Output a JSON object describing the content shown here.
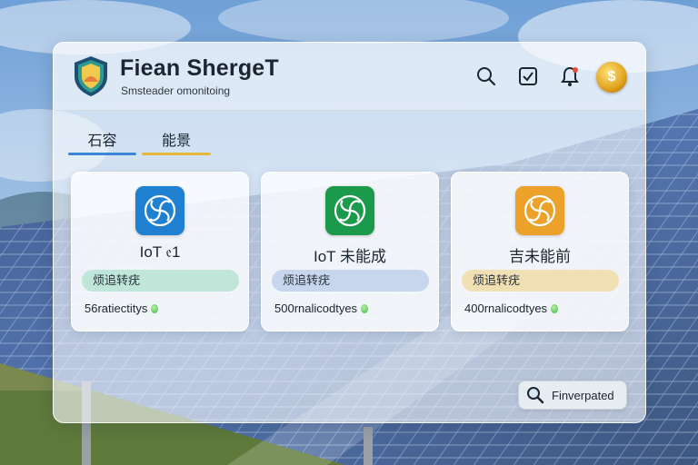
{
  "app": {
    "title": "Fiean ShergeT",
    "subtitle": "Smsteader omonitoing"
  },
  "header_icons": [
    "search-icon",
    "checkbox-icon",
    "bell-icon",
    "coin-avatar-icon"
  ],
  "avatar": {
    "symbol": "$"
  },
  "tabs": [
    {
      "label": "石容",
      "underline_color": "#3c86d6"
    },
    {
      "label": "能景",
      "underline_color": "#e6b83e"
    }
  ],
  "cards": [
    {
      "icon": "fan-swirl-icon",
      "icon_color": "#1f7fd0",
      "name": "IoT 𝔢1",
      "pill": "烦追转疣",
      "pill_color": "#bfe6d8",
      "count": "56ratiectitys"
    },
    {
      "icon": "fan-swirl-icon",
      "icon_color": "#1c9a4c",
      "name": "IoT 未能成",
      "pill": "烦追转疣",
      "pill_color": "#c7d6ec",
      "count": "500rnalicodtyes"
    },
    {
      "icon": "fan-swirl-icon",
      "icon_color": "#eca22a",
      "name": "吉未能前",
      "pill": "烦追转疣",
      "pill_color": "#f1e0b4",
      "count": "400rnalicodtyes"
    }
  ],
  "action": {
    "label": "Finverpated",
    "icon": "magnifier-icon"
  }
}
